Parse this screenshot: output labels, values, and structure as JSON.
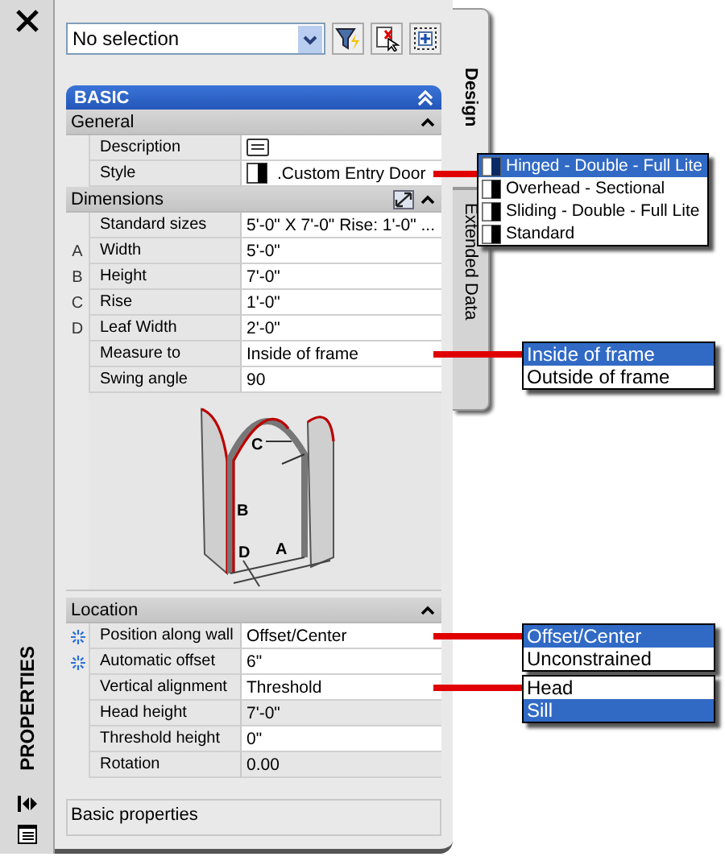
{
  "panel_label": "PROPERTIES",
  "selection": {
    "value": "No selection"
  },
  "tabs": [
    {
      "label": "Design",
      "selected": true
    },
    {
      "label": "Extended Data",
      "selected": false
    }
  ],
  "sections": [
    {
      "title": "BASIC",
      "categories": [
        {
          "title": "General",
          "kind": "plain",
          "rows": [
            {
              "kind": "description",
              "label": "Description",
              "readonly": false
            },
            {
              "kind": "style",
              "label": "Style",
              "value": ".Custom Entry Door",
              "readonly": false,
              "options": [
                {
                  "label": "Hinged - Double - Full Lite",
                  "selected": true
                },
                {
                  "label": "Overhead - Sectional",
                  "selected": false
                },
                {
                  "label": "Sliding - Double - Full Lite",
                  "selected": false
                },
                {
                  "label": "Standard",
                  "selected": false
                }
              ]
            }
          ]
        },
        {
          "title": "Dimensions",
          "kind": "dimensions",
          "illustration_labels": [
            "C",
            "B",
            "D",
            "A"
          ],
          "rows": [
            {
              "kind": "text",
              "label": "Standard sizes",
              "value": "5'-0\" X 7'-0\" Rise: 1'-0\" ...",
              "readonly": false
            },
            {
              "kind": "text",
              "letter": "A",
              "label": "Width",
              "value": "5'-0\"",
              "readonly": false
            },
            {
              "kind": "text",
              "letter": "B",
              "label": "Height",
              "value": "7'-0\"",
              "readonly": false
            },
            {
              "kind": "text",
              "letter": "C",
              "label": "Rise",
              "value": "1'-0\"",
              "readonly": false
            },
            {
              "kind": "text",
              "letter": "D",
              "label": "Leaf Width",
              "value": "2'-0\"",
              "readonly": false
            },
            {
              "kind": "text",
              "label": "Measure to",
              "value": "Inside of frame",
              "readonly": false,
              "options": [
                {
                  "label": "Inside of frame",
                  "selected": true
                },
                {
                  "label": "Outside of frame",
                  "selected": false
                }
              ]
            },
            {
              "kind": "text",
              "label": "Swing angle",
              "value": "90",
              "readonly": false
            }
          ]
        },
        {
          "title": "Location",
          "kind": "plain",
          "rows": [
            {
              "kind": "text",
              "linked": true,
              "label": "Position along wall",
              "value": "Offset/Center",
              "readonly": false,
              "options": [
                {
                  "label": "Offset/Center",
                  "selected": true
                },
                {
                  "label": "Unconstrained",
                  "selected": false
                }
              ]
            },
            {
              "kind": "text",
              "linked": true,
              "label": "Automatic offset",
              "value": "6\"",
              "readonly": false
            },
            {
              "kind": "text",
              "linked": false,
              "label": "Vertical alignment",
              "value": "Threshold",
              "readonly": false,
              "options": [
                {
                  "label": "Head",
                  "selected": false
                },
                {
                  "label": "Sill",
                  "selected": true
                }
              ]
            },
            {
              "kind": "text",
              "linked": false,
              "label": "Head height",
              "value": "7'-0\"",
              "readonly": true
            },
            {
              "kind": "text",
              "linked": false,
              "label": "Threshold height",
              "value": "0\"",
              "readonly": false
            },
            {
              "kind": "text",
              "linked": false,
              "label": "Rotation",
              "value": "0.00",
              "readonly": true
            }
          ]
        }
      ]
    }
  ],
  "description": "Basic properties"
}
